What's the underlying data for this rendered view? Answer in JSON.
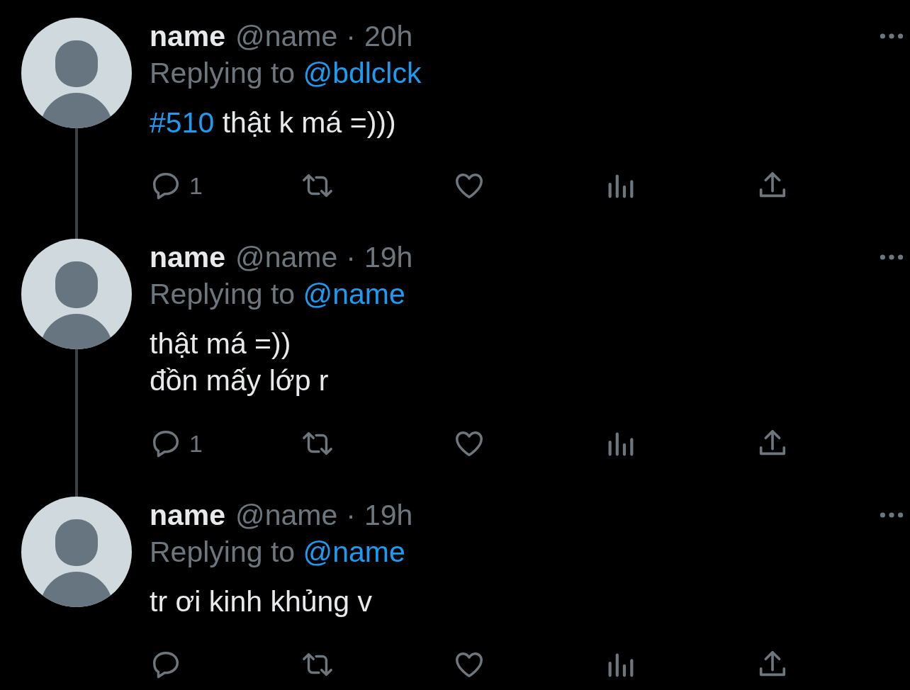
{
  "tweets": [
    {
      "name": "name",
      "handle": "@name",
      "separator": "·",
      "time": "20h",
      "replying_label": "Replying to",
      "replying_to": "@bdlclck",
      "lines": [
        {
          "hashtag": "#510",
          "text": "thật k má =)))"
        }
      ],
      "reply_count": "1"
    },
    {
      "name": "name",
      "handle": "@name",
      "separator": "·",
      "time": "19h",
      "replying_label": "Replying to",
      "replying_to": "@name",
      "lines": [
        {
          "text": "thật má =))"
        },
        {
          "text": "đồn mấy lớp r"
        }
      ],
      "reply_count": "1"
    },
    {
      "name": "name",
      "handle": "@name",
      "separator": "·",
      "time": "19h",
      "replying_label": "Replying to",
      "replying_to": "@name",
      "lines": [
        {
          "text": "tr ơi kinh khủng v"
        }
      ]
    }
  ]
}
